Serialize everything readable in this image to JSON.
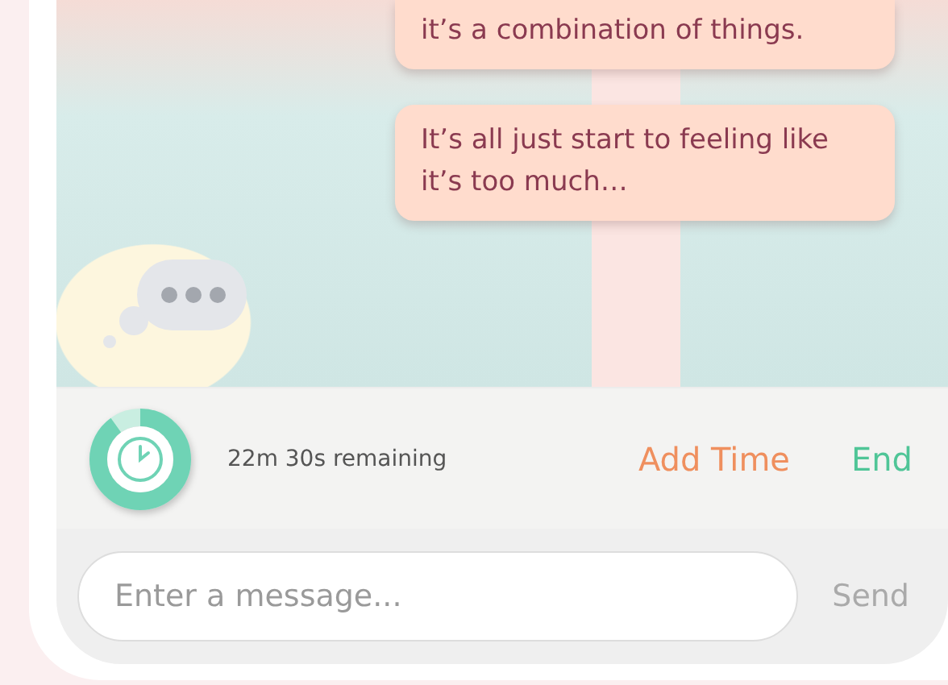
{
  "messages": [
    {
      "text": "it’s a combination of things."
    },
    {
      "text": "It’s all just start to feeling like it’s too much…"
    }
  ],
  "timer": {
    "level": 0.9,
    "remaining": "22m 30s remaining"
  },
  "actions": [
    {
      "label": "Add Time",
      "kind": "add"
    },
    {
      "label": "End",
      "kind": "end"
    }
  ],
  "composer": {
    "placeholder": "Enter a message...",
    "send": "Send"
  }
}
